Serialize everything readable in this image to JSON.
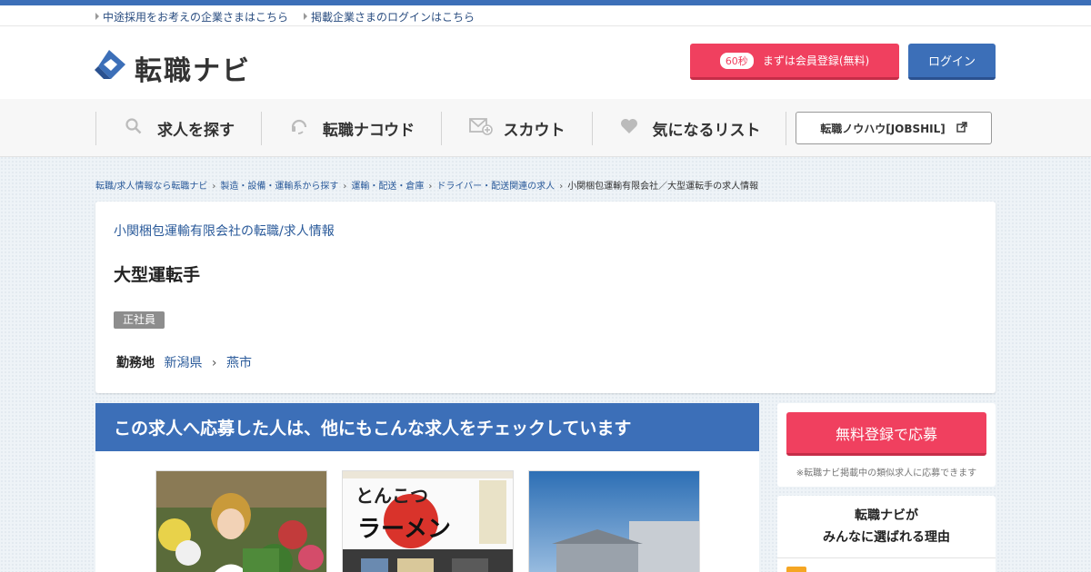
{
  "subnav": {
    "link1": "中途採用をお考えの企業さまはこちら",
    "link2": "掲載企業さまのログインはこちら"
  },
  "header": {
    "logo_text": "転職ナビ",
    "register_badge": "60秒",
    "register_label": "まずは会員登録(無料)",
    "login_label": "ログイン"
  },
  "nav": {
    "items": [
      {
        "label": "求人を探す",
        "icon": "search-icon"
      },
      {
        "label": "転職ナコウド",
        "icon": "headset-icon"
      },
      {
        "label": "スカウト",
        "icon": "mail-plus-icon"
      },
      {
        "label": "気になるリスト",
        "icon": "heart-icon"
      }
    ],
    "jobshil_label": "転職ノウハウ[JOBSHIL]"
  },
  "breadcrumb": [
    "転職/求人情報なら転職ナビ",
    "製造・設備・運輸系から探す",
    "運輸・配送・倉庫",
    "ドライバー・配送関連の求人",
    "小関梱包運輸有限会社／大型運転手の求人情報"
  ],
  "job": {
    "company_link": "小関梱包運輸有限会社の転職/求人情報",
    "title": "大型運転手",
    "employment_type": "正社員",
    "location_label": "勤務地",
    "prefecture": "新潟県",
    "city": "燕市"
  },
  "recommend": {
    "heading": "この求人へ応募した人は、他にもこんな求人をチェックしています",
    "sign_top": "とんこつ",
    "sign_main": "ラーメン"
  },
  "sidebar": {
    "apply_label": "無料登録で応募",
    "apply_note": "※転職ナビ掲載中の類似求人に応募できます",
    "why_line1": "転職ナビが",
    "why_line2": "みんなに選ばれる理由"
  },
  "colors": {
    "brand_blue": "#3c6fb8",
    "accent_pink": "#f0405f",
    "link": "#2a5a9a"
  }
}
